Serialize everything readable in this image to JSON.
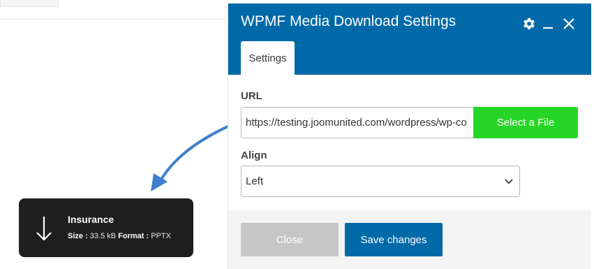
{
  "modal": {
    "title": "WPMF Media Download Settings",
    "tabs": [
      {
        "label": "Settings",
        "active": true
      }
    ],
    "url": {
      "label": "URL",
      "value": "https://testing.joomunited.com/wordpress/wp-co",
      "select_button": "Select a File"
    },
    "align": {
      "label": "Align",
      "selected": "Left"
    },
    "footer": {
      "close_label": "Close",
      "save_label": "Save changes"
    },
    "header_icons": [
      "gear-icon",
      "minimize-icon",
      "close-icon"
    ]
  },
  "download_card": {
    "title": "Insurance",
    "size_label": "Size :",
    "size_value": "33.5 kB",
    "format_label": "Format :",
    "format_value": "PPTX",
    "icon": "arrow-down-icon"
  },
  "colors": {
    "header_blue": "#0069a8",
    "select_green": "#26d626",
    "close_gray": "#c6c6c6",
    "card_dark": "#1f1f1f",
    "annotation_arrow": "#3f7fce"
  }
}
